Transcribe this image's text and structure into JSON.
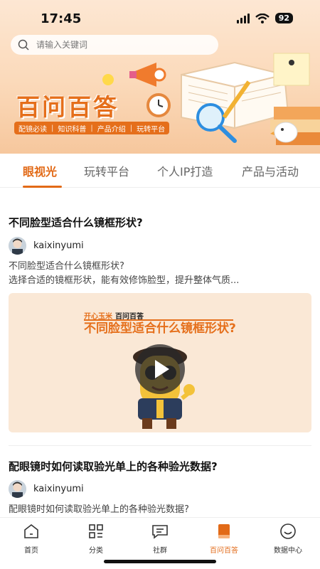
{
  "status_bar": {
    "time": "17:45",
    "battery": "92"
  },
  "search": {
    "placeholder": "请输入关键词"
  },
  "banner": {
    "title": "百问百答",
    "tags": [
      "配镜必读",
      "知识科普",
      "产品介绍",
      "玩转平台"
    ]
  },
  "tabs": [
    {
      "label": "眼视光",
      "active": true
    },
    {
      "label": "玩转平台",
      "active": false
    },
    {
      "label": "个人IP打造",
      "active": false
    },
    {
      "label": "产品与活动",
      "active": false
    }
  ],
  "articles": [
    {
      "title": "不同脸型适合什么镜框形状?",
      "author": "kaixinyumi",
      "excerpt_line1": "不同脸型适合什么镜框形状?",
      "excerpt_line2": "选择合适的镜框形状，能有效修饰脸型，提升整体气质...",
      "video": {
        "brand": "开心玉米",
        "brand_suffix": "百问百答",
        "title": "不同脸型适合什么镜框形状?"
      }
    },
    {
      "title": "配眼镜时如何读取验光单上的各种验光数据?",
      "author": "kaixinyumi",
      "excerpt_line1": "配眼镜时如何读取验光单上的各种验光数据?"
    }
  ],
  "bottom_nav": [
    {
      "label": "首页",
      "icon": "home-icon",
      "active": false
    },
    {
      "label": "分类",
      "icon": "grid-icon",
      "active": false
    },
    {
      "label": "社群",
      "icon": "chat-icon",
      "active": false
    },
    {
      "label": "百问百答",
      "icon": "book-icon",
      "active": true
    },
    {
      "label": "数据中心",
      "icon": "smile-icon",
      "active": false
    }
  ],
  "colors": {
    "accent": "#e26a17",
    "banner_bg": "#fbd9b9",
    "card_bg": "#fae8d6"
  }
}
